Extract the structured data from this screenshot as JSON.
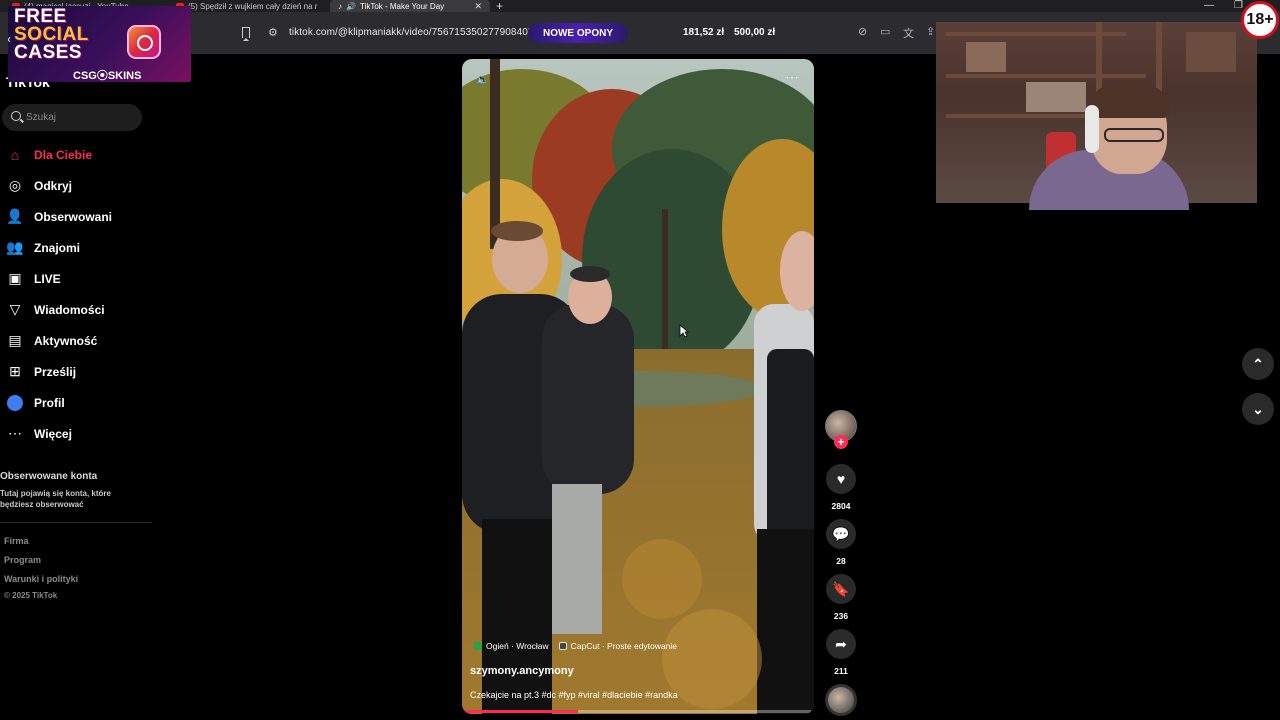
{
  "browser": {
    "tabs": [
      {
        "title": "(4) magical jaccuzi - YouTube"
      },
      {
        "title": "(5) Spędził z wujkiem cały dzień na r"
      },
      {
        "title": "TikTok - Make Your Day"
      }
    ],
    "url": "tiktok.com/@klipmaniakk/video/7567153502779084054",
    "promo_label": "NOWE OPONY",
    "price_1": "181,52 zł",
    "price_2": "500,00 zł"
  },
  "ad": {
    "headline_1": "FREE",
    "headline_2": "SOCIAL",
    "headline_3": "CASES",
    "brand": "CSG⦿SKINS"
  },
  "sidebar": {
    "logo_text": "TikTok",
    "search_placeholder": "Szukaj",
    "items": [
      {
        "label": "Dla Ciebie",
        "icon": "home-icon"
      },
      {
        "label": "Odkryj",
        "icon": "compass-icon"
      },
      {
        "label": "Obserwowani",
        "icon": "user-plus-icon"
      },
      {
        "label": "Znajomi",
        "icon": "friends-icon"
      },
      {
        "label": "LIVE",
        "icon": "live-icon"
      },
      {
        "label": "Wiadomości",
        "icon": "send-icon"
      },
      {
        "label": "Aktywność",
        "icon": "inbox-icon"
      },
      {
        "label": "Prześlij",
        "icon": "upload-icon"
      },
      {
        "label": "Profil",
        "icon": "avatar-icon"
      },
      {
        "label": "Więcej",
        "icon": "more-icon"
      }
    ],
    "followed_title": "Obserwowane konta",
    "followed_desc": "Tutaj pojawią się konta, które będziesz obserwować",
    "footer_links": [
      "Firma",
      "Program",
      "Warunki i polityki"
    ],
    "copyright": "© 2025 TikTok"
  },
  "video": {
    "tags": [
      {
        "label": "Ogień · Wrocław"
      },
      {
        "label": "CapCut · Proste edytowanie"
      }
    ],
    "author": "szymony.ancymony",
    "caption": "Czekajcie na pt.3 #dc #fyp #viral #dlaciebie #randka",
    "progress": 0.33
  },
  "actions": {
    "likes": "2804",
    "comments": "28",
    "saves": "236",
    "shares": "211"
  },
  "overlay": {
    "age_badge": "18+"
  },
  "colors": {
    "accent": "#fe2c55",
    "background": "#000000",
    "promo": "#4a1fb0"
  }
}
